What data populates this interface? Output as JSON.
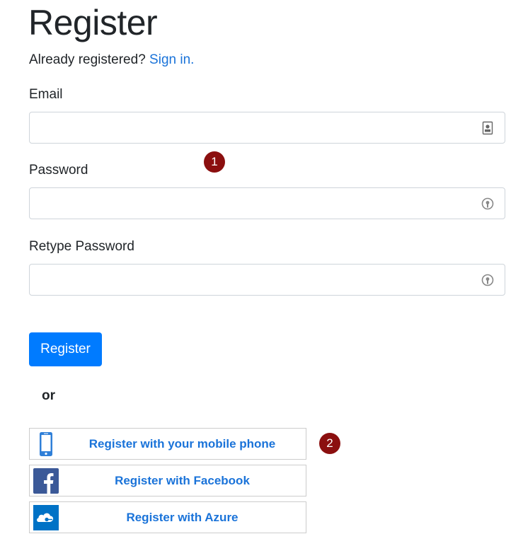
{
  "page": {
    "title": "Register",
    "already_text": "Already registered?",
    "signin_link": "Sign in."
  },
  "form": {
    "email_label": "Email",
    "email_value": "",
    "password_label": "Password",
    "password_value": "",
    "retype_label": "Retype Password",
    "retype_value": "",
    "submit_label": "Register"
  },
  "divider": "or",
  "social": {
    "phone_label": "Register with your mobile phone",
    "facebook_label": "Register with Facebook",
    "azure_label": "Register with Azure"
  },
  "markers": {
    "one": "1",
    "two": "2"
  },
  "colors": {
    "primary": "#007bff",
    "link": "#1a73d9",
    "marker": "#8b0f0f",
    "facebook": "#3b5998",
    "azure": "#0072c6"
  },
  "icons": {
    "email_field": "contact-card-icon",
    "password_field": "key-autofill-icon",
    "phone": "mobile-phone-icon",
    "facebook": "facebook-logo-icon",
    "azure": "azure-cloud-icon"
  }
}
